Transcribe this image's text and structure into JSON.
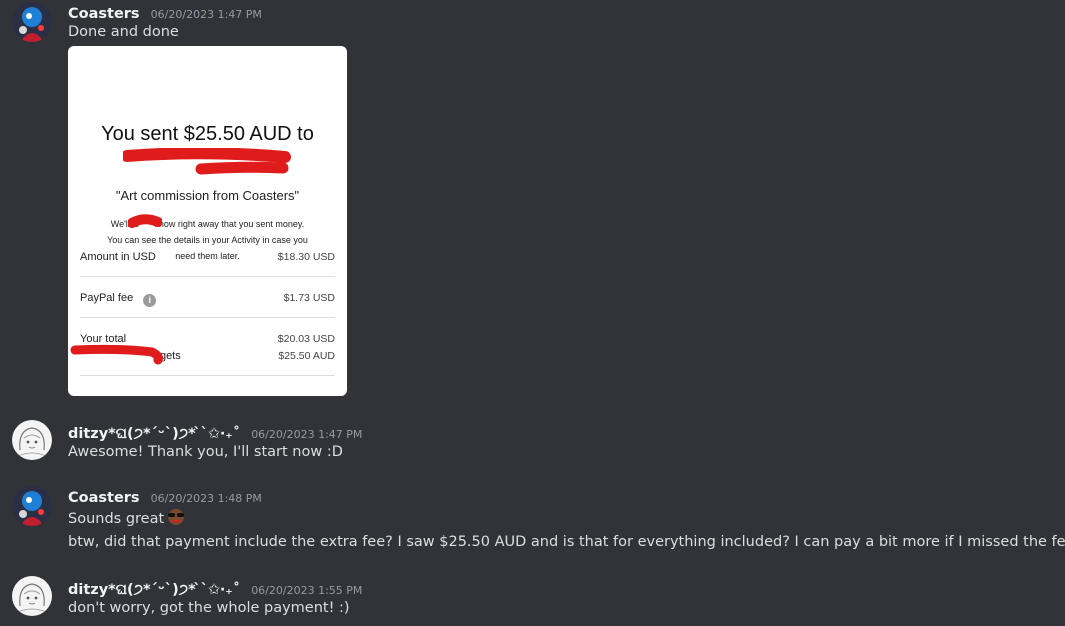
{
  "messages": [
    {
      "username": "Coasters",
      "timestamp": "06/20/2023 1:47 PM",
      "text": "Done and done",
      "avatar": "coasters-avatar"
    },
    {
      "username": "ditzy*ଘ(੭*ˊᵕˋ)੭* ̀ˋ✩‧₊˚",
      "timestamp": "06/20/2023 1:47 PM",
      "text": "Awesome! Thank you, I'll start now :D",
      "avatar": "ditzy-avatar"
    },
    {
      "username": "Coasters",
      "timestamp": "06/20/2023 1:48 PM",
      "text": "Sounds great",
      "emoji": "sunglasses-emoji",
      "text2": "btw, did that payment include the extra fee? I saw $25.50 AUD and is that for everything included? I can pay a bit more if I missed the fee lol",
      "avatar": "coasters-avatar"
    },
    {
      "username": "ditzy*ଘ(੭*ˊᵕˋ)੭* ̀ˋ✩‧₊˚",
      "timestamp": "06/20/2023 1:55 PM",
      "text": "don't worry, got the whole payment! :)",
      "avatar": "ditzy-avatar"
    }
  ],
  "attachment": {
    "title": "You sent $25.50 AUD to",
    "note": "\"Art commission from Coasters\"",
    "desc_line1": "We'll le      know right away that you sent money.",
    "desc_line2": "You can see the details in your Activity in case you",
    "desc_line3": "need them later.",
    "rows": [
      {
        "label": "Amount in USD",
        "value": "$18.30 USD"
      },
      {
        "label": "PayPal fee",
        "value": "$1.73 USD"
      },
      {
        "label": "Your total",
        "value": "$20.03 USD"
      },
      {
        "label": "gets",
        "value": "$25.50 AUD"
      }
    ],
    "redaction_color": "#e01b1b"
  }
}
